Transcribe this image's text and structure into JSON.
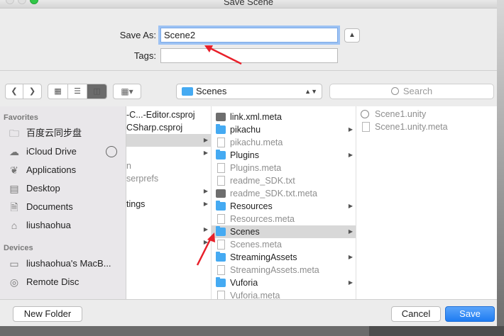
{
  "window": {
    "title": "Save Scene"
  },
  "form": {
    "save_as_label": "Save As:",
    "save_as_value": "Scene2",
    "tags_label": "Tags:",
    "tags_value": "",
    "expand_icon": "chevron-up-icon"
  },
  "toolbar": {
    "back_icon": "chevron-left-icon",
    "forward_icon": "chevron-right-icon",
    "view_modes": [
      "icon-view-icon",
      "list-view-icon",
      "column-view-icon"
    ],
    "arrange_icon": "gallery-grid-icon",
    "location": "Scenes",
    "search_placeholder": "Search"
  },
  "sidebar": {
    "favorites_header": "Favorites",
    "favorites": [
      {
        "label": "百度云同步盘",
        "icon": "folder-icon"
      },
      {
        "label": "iCloud Drive",
        "icon": "cloud-icon"
      },
      {
        "label": "Applications",
        "icon": "applications-icon"
      },
      {
        "label": "Desktop",
        "icon": "desktop-icon"
      },
      {
        "label": "Documents",
        "icon": "documents-icon"
      },
      {
        "label": "liushaohua",
        "icon": "home-icon"
      }
    ],
    "devices_header": "Devices",
    "devices": [
      {
        "label": "liushaohua's MacB...",
        "icon": "laptop-icon"
      },
      {
        "label": "Remote Disc",
        "icon": "disc-icon"
      }
    ]
  },
  "columns": {
    "col1": [
      {
        "text": "-C...-Editor.csproj",
        "sel": false
      },
      {
        "text": "CSharp.csproj",
        "sel": false
      },
      {
        "text": "",
        "sel": true,
        "chevron": true
      },
      {
        "text": "",
        "sel": false,
        "chevron": true
      },
      {
        "text": "n",
        "sel": false
      },
      {
        "text": "serprefs",
        "sel": false
      },
      {
        "text": "",
        "sel": false,
        "chevron": true
      },
      {
        "text": "tings",
        "sel": false,
        "chevron": true
      },
      {
        "text": "",
        "sel": false,
        "chevron": true
      },
      {
        "text": "",
        "sel": false,
        "chevron": true
      }
    ],
    "col2": [
      {
        "text": "link.xml.meta",
        "type": "dark",
        "grey": false
      },
      {
        "text": "pikachu",
        "type": "folder",
        "chevron": true
      },
      {
        "text": "pikachu.meta",
        "type": "file",
        "grey": true
      },
      {
        "text": "Plugins",
        "type": "folder",
        "chevron": true
      },
      {
        "text": "Plugins.meta",
        "type": "file",
        "grey": true
      },
      {
        "text": "readme_SDK.txt",
        "type": "file",
        "grey": true
      },
      {
        "text": "readme_SDK.txt.meta",
        "type": "dark",
        "grey": true
      },
      {
        "text": "Resources",
        "type": "folder",
        "chevron": true
      },
      {
        "text": "Resources.meta",
        "type": "file",
        "grey": true
      },
      {
        "text": "Scenes",
        "type": "folder",
        "chevron": true,
        "sel": true
      },
      {
        "text": "Scenes.meta",
        "type": "file",
        "grey": true
      },
      {
        "text": "StreamingAssets",
        "type": "folder",
        "chevron": true
      },
      {
        "text": "StreamingAssets.meta",
        "type": "file",
        "grey": true
      },
      {
        "text": "Vuforia",
        "type": "folder",
        "chevron": true
      },
      {
        "text": "Vuforia.meta",
        "type": "file",
        "grey": true
      }
    ],
    "col3": [
      {
        "text": "Scene1.unity",
        "type": "unity"
      },
      {
        "text": "Scene1.unity.meta",
        "type": "file"
      }
    ]
  },
  "buttons": {
    "new_folder": "New Folder",
    "cancel": "Cancel",
    "save": "Save"
  },
  "colors": {
    "accent": "#1e7cf2",
    "folder": "#45aaf2",
    "annotation": "#e8202a"
  }
}
